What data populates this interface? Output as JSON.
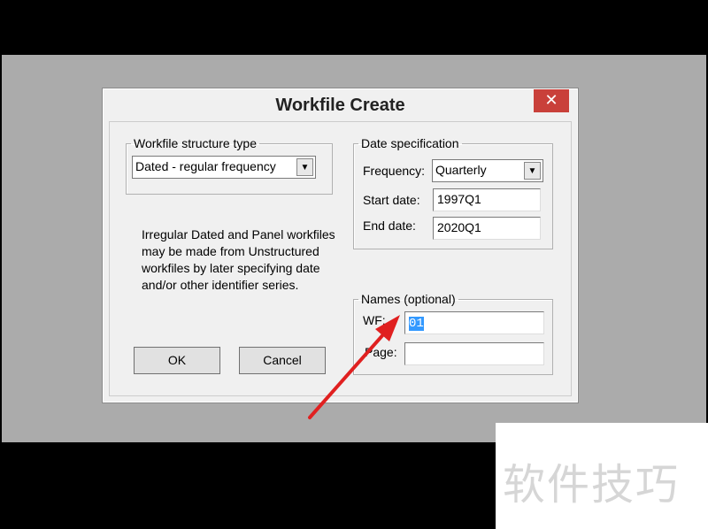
{
  "dialog": {
    "title": "Workfile Create",
    "close": "✕"
  },
  "structure": {
    "legend": "Workfile structure type",
    "value": "Dated - regular frequency"
  },
  "note": "Irregular Dated and Panel workfiles may be made from Unstructured workfiles by later specifying date and/or other identifier series.",
  "date_spec": {
    "legend": "Date specification",
    "frequency_label": "Frequency:",
    "frequency": "Quarterly",
    "start_label": "Start date:",
    "start": "1997Q1",
    "end_label": "End date:",
    "end": "2020Q1"
  },
  "names": {
    "legend": "Names (optional)",
    "wf_label": "WF:",
    "wf": "01",
    "page_label": "Page:",
    "page": ""
  },
  "buttons": {
    "ok": "OK",
    "cancel": "Cancel"
  },
  "watermark": "软件技巧",
  "colors": {
    "close": "#c9403a",
    "arrow": "#e02020",
    "selection": "#3399ff"
  }
}
